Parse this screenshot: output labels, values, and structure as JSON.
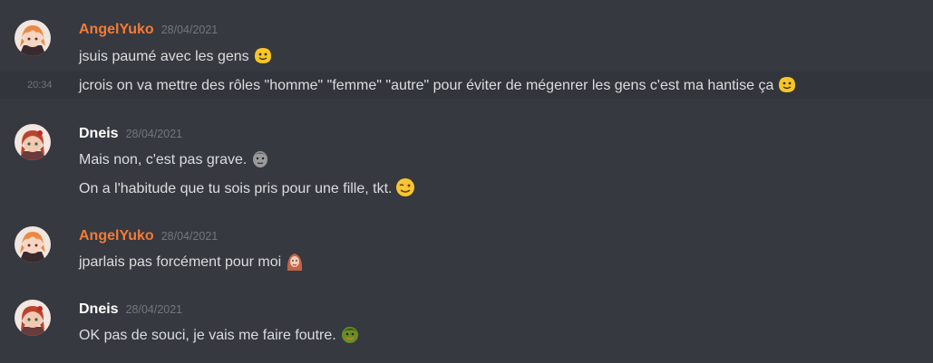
{
  "messages": [
    {
      "author": "AngelYuko",
      "date": "28/04/2021",
      "lines": [
        {
          "text": "jsuis paumé avec les gens",
          "emoji": "blob-smile-icon"
        },
        {
          "text": "jcrois on va mettre des rôles \"homme\" \"femme\" \"autre\" pour éviter de mégenrer les gens c'est ma hantise ça",
          "emoji": "blob-smile-icon",
          "timestamp": "20:34"
        }
      ]
    },
    {
      "author": "Dneis",
      "date": "28/04/2021",
      "lines": [
        {
          "text": "Mais non, c'est pas grave.",
          "emoji": "kappa-face-icon"
        },
        {
          "text": "On a l'habitude que tu sois pris pour une fille, tkt.",
          "emoji": "winking-face-icon"
        }
      ]
    },
    {
      "author": "AngelYuko",
      "date": "28/04/2021",
      "lines": [
        {
          "text": "jparlais pas forcément pour moi",
          "emoji": "anime-girl-icon"
        }
      ]
    },
    {
      "author": "Dneis",
      "date": "28/04/2021",
      "lines": [
        {
          "text": "OK pas de souci, je vais me faire foutre.",
          "emoji": "green-troll-icon"
        }
      ]
    }
  ],
  "colors": {
    "background": "#36393f",
    "angel_name": "#f47b38",
    "dneis_name": "#ffffff",
    "message_text": "#dcddde",
    "muted": "#72767d",
    "hover_row": "#32353b"
  }
}
